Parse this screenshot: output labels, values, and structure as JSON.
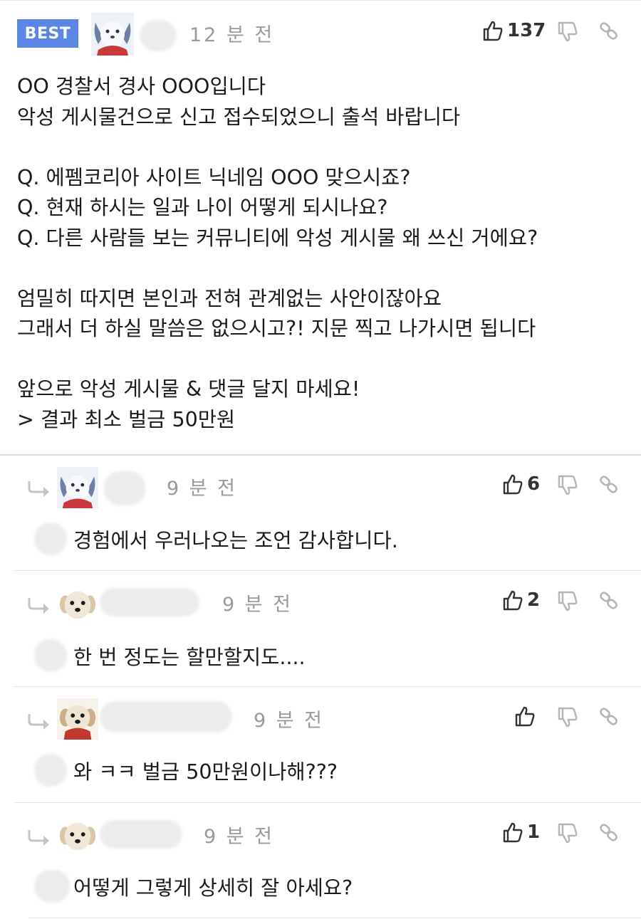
{
  "best_comment": {
    "badge": "BEST",
    "time": "12 분 전",
    "likes": "137",
    "body": [
      "OO 경찰서 경사 OOO입니다",
      "악성 게시물건으로 신고 접수되었으니 출석 바랍니다",
      "",
      "Q. 에펨코리아 사이트 닉네임 OOO 맞으시죠?",
      "Q. 현재 하시는 일과 나이 어떻게 되시나요?",
      "Q. 다른 사람들 보는 커뮤니티에 악성 게시물 왜 쓰신 거에요?",
      "",
      "엄밀히 따지면 본인과 전혀 관계없는 사안이잖아요",
      "그래서 더 하실 말씀은 없으시고?! 지문 찍고 나가시면 됩니다",
      "",
      "앞으로 악성 게시물 & 댓글 달지 마세요!",
      "> 결과 최소 벌금 50만원"
    ]
  },
  "replies": [
    {
      "time": "9 분 전",
      "likes": "6",
      "text": "경험에서 우러나오는 조언 감사합니다."
    },
    {
      "time": "9 분 전",
      "likes": "2",
      "text": "한 번 정도는 할만할지도...."
    },
    {
      "time": "9 분 전",
      "likes": "",
      "text": "와 ㅋㅋ 벌금 50만원이나해???"
    },
    {
      "time": "9 분 전",
      "likes": "1",
      "text": "어떻게 그렇게 상세히 잘 아세요?"
    }
  ],
  "icons": {
    "like": "thumbs-up-icon",
    "dislike": "thumbs-down-icon",
    "link": "link-icon",
    "reply": "reply-arrow-icon"
  },
  "colors": {
    "best_badge": "#5b86e5",
    "timestamp": "#9a9a9a",
    "icon_gray": "#b5b5b5"
  }
}
